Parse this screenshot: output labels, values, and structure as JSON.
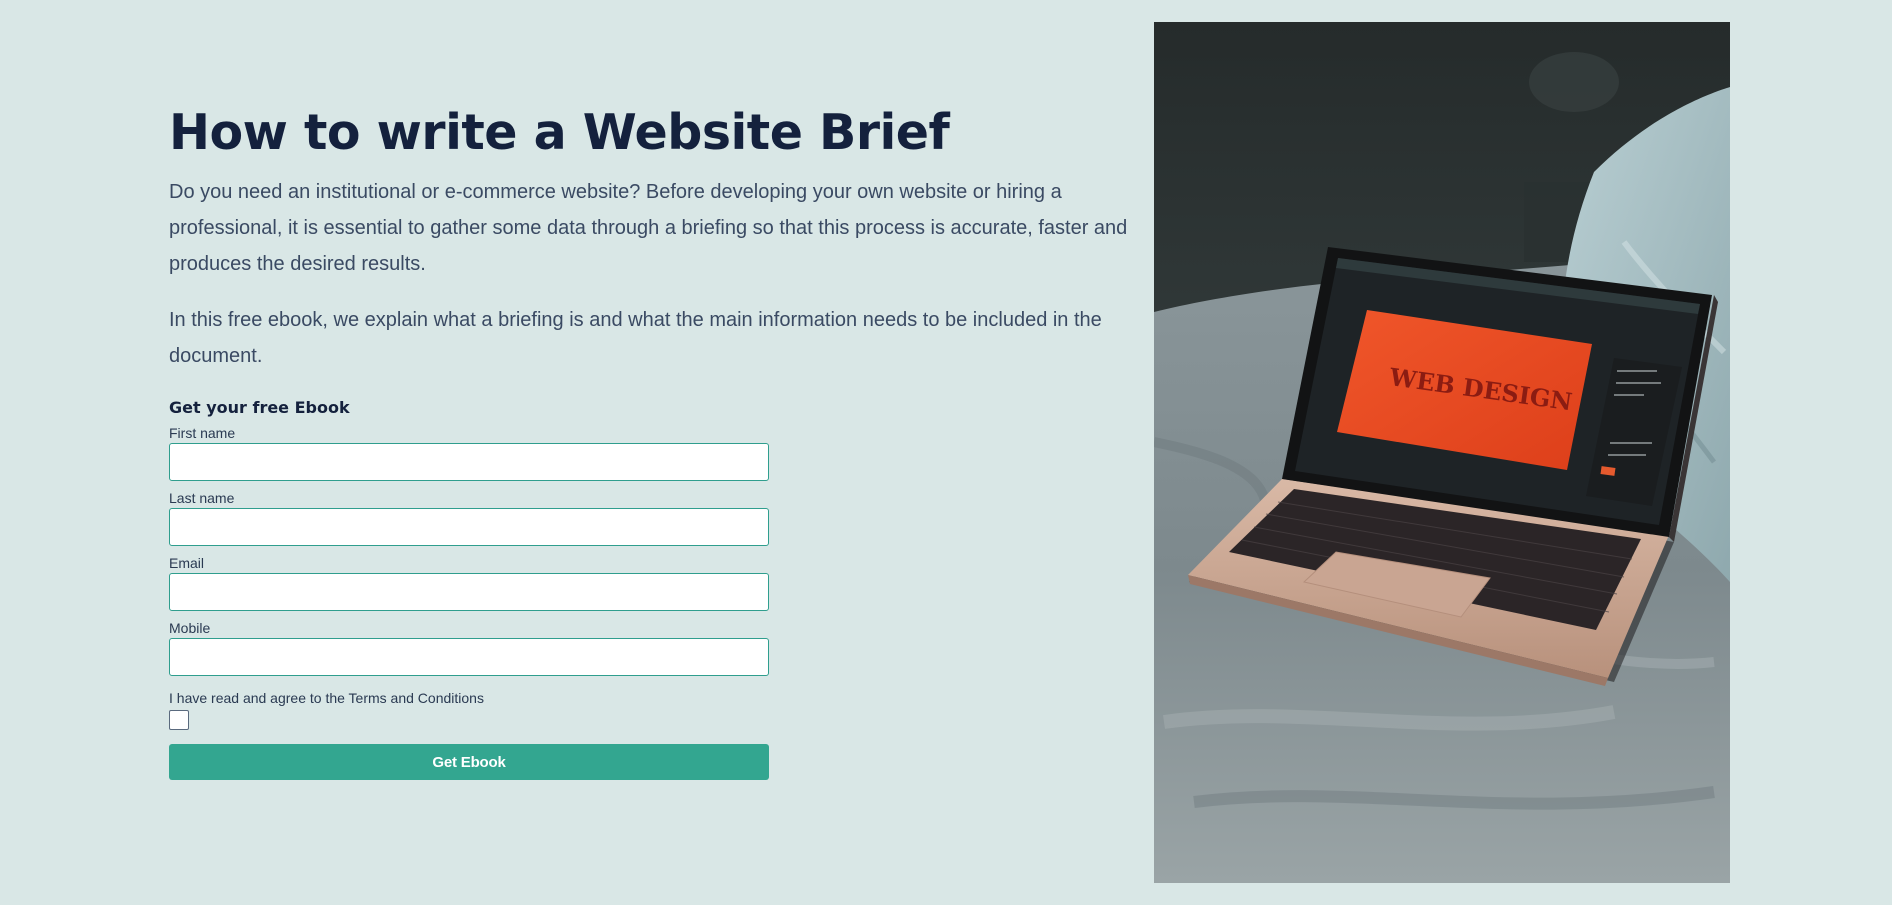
{
  "hero": {
    "title": "How to write a Website Brief",
    "paragraph_1": "Do you need an institutional or e-commerce website? Before developing your own website or hiring a professional, it is essential to gather some data through a briefing so that this process is accurate, faster and produces the desired results.",
    "paragraph_2": "In this free ebook, we explain what a briefing is and what the main information needs to be included in the document."
  },
  "form": {
    "heading": "Get your free Ebook",
    "fields": {
      "first_name": {
        "label": "First name",
        "value": "",
        "placeholder": ""
      },
      "last_name": {
        "label": "Last name",
        "value": "",
        "placeholder": ""
      },
      "email": {
        "label": "Email",
        "value": "",
        "placeholder": ""
      },
      "mobile": {
        "label": "Mobile",
        "value": "",
        "placeholder": ""
      }
    },
    "terms_label": "I have read and agree to the Terms and Conditions",
    "terms_checked": false,
    "submit_label": "Get Ebook"
  },
  "image": {
    "screen_text": "WEB DESIGN"
  },
  "colors": {
    "background": "#d9e7e6",
    "heading": "#14213d",
    "body_text": "#3a4a63",
    "field_border": "#2f9e8e",
    "button": "#33a690",
    "button_text": "#ffffff"
  }
}
